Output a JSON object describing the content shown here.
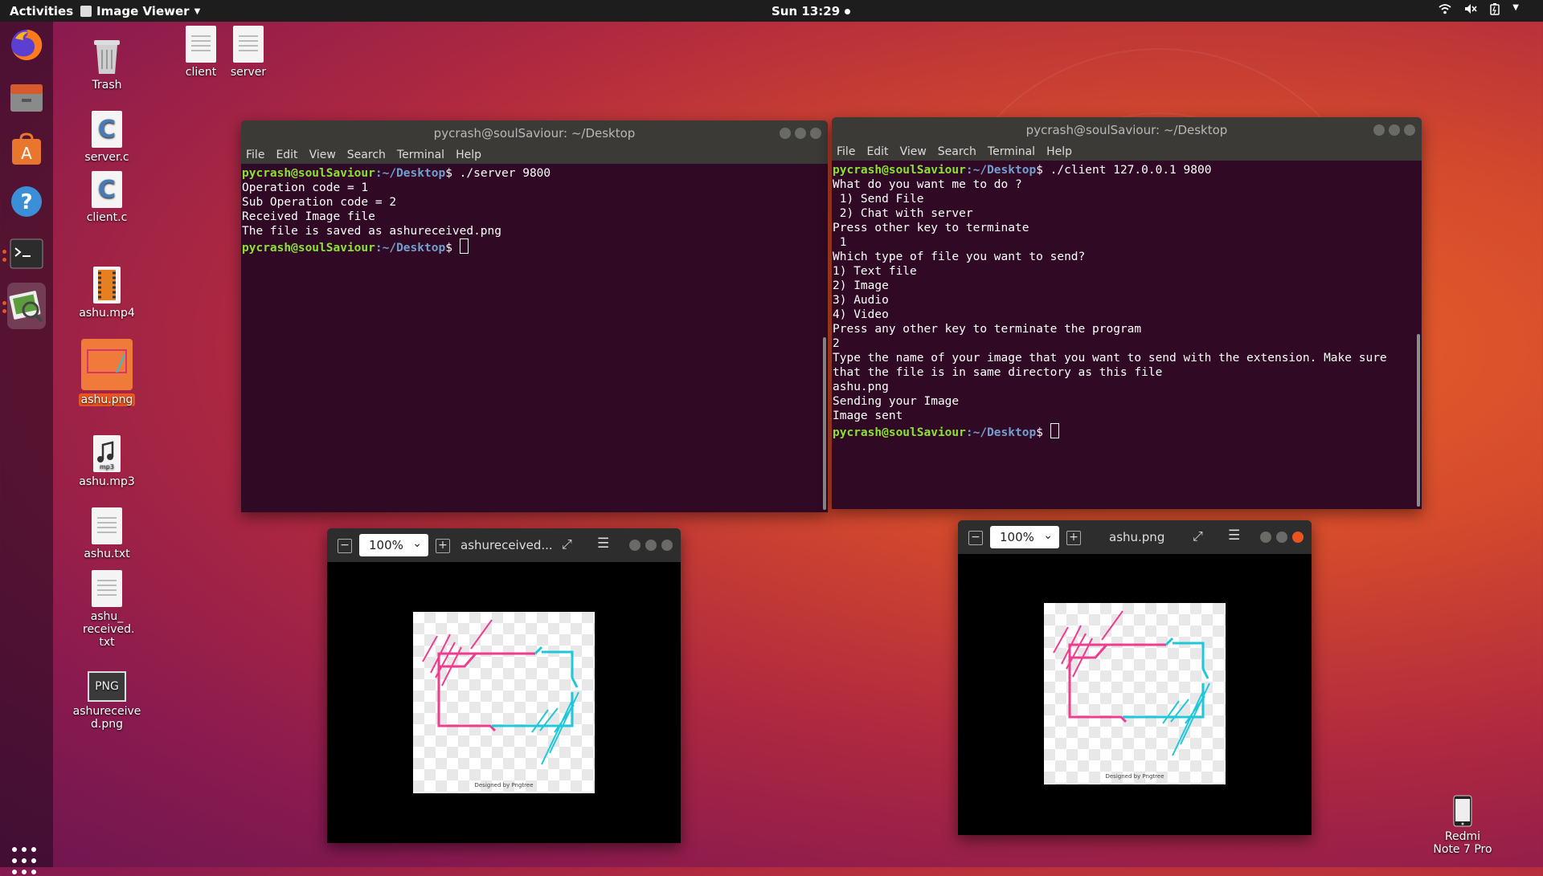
{
  "topbar": {
    "activities": "Activities",
    "app_name": "Image Viewer",
    "clock": "Sun 13:29"
  },
  "dock": {
    "items": [
      {
        "name": "firefox-icon"
      },
      {
        "name": "files-icon"
      },
      {
        "name": "software-icon"
      },
      {
        "name": "help-icon"
      },
      {
        "name": "terminal-icon"
      },
      {
        "name": "image-viewer-icon"
      }
    ]
  },
  "desktop": {
    "icons": [
      {
        "label": "Trash",
        "type": "trash"
      },
      {
        "label": "client",
        "type": "doc"
      },
      {
        "label": "server",
        "type": "doc"
      },
      {
        "label": "server.c",
        "type": "c"
      },
      {
        "label": "client.c",
        "type": "c"
      },
      {
        "label": "ashu.mp4",
        "type": "video"
      },
      {
        "label": "ashu.png",
        "type": "image"
      },
      {
        "label": "ashu.mp3",
        "type": "audio"
      },
      {
        "label": "ashu.txt",
        "type": "doc"
      },
      {
        "label": "ashu_ received. txt",
        "type": "doc"
      },
      {
        "label": "ashureceive d.png",
        "type": "png"
      }
    ],
    "phone": {
      "label": "Redmi Note 7 Pro"
    }
  },
  "terminal_server": {
    "title": "pycrash@soulSaviour: ~/Desktop",
    "menu": [
      "File",
      "Edit",
      "View",
      "Search",
      "Terminal",
      "Help"
    ],
    "prompt_user": "pycrash@soulSaviour",
    "prompt_path": ":~/Desktop",
    "command": "$ ./server 9800",
    "output": [
      "Operation code = 1",
      "Sub Operation code = 2",
      "Received Image file",
      "The file is saved as ashureceived.png"
    ],
    "end_prompt_dollar": "$ "
  },
  "terminal_client": {
    "title": "pycrash@soulSaviour: ~/Desktop",
    "menu": [
      "File",
      "Edit",
      "View",
      "Search",
      "Terminal",
      "Help"
    ],
    "prompt_user": "pycrash@soulSaviour",
    "prompt_path": ":~/Desktop",
    "command": "$ ./client 127.0.0.1 9800",
    "output": [
      "What do you want me to do ?",
      " 1) Send File",
      " 2) Chat with server",
      "Press other key to terminate",
      " 1",
      "Which type of file you want to send?",
      "1) Text file",
      "2) Image",
      "3) Audio",
      "4) Video",
      "Press any other key to terminate the program",
      "2",
      "Type the name of your image that you want to send with the extension. Make sure that the file is in same directory as this file",
      "ashu.png",
      "Sending your Image",
      "Image sent"
    ],
    "end_prompt_dollar": "$ "
  },
  "viewer_left": {
    "zoom": "100%",
    "title": "ashureceived...",
    "credit": "Designed by Pngtree"
  },
  "viewer_right": {
    "zoom": "100%",
    "title": "ashu.png",
    "credit": "Designed by Pngtree"
  },
  "colors": {
    "accent": "#e95420",
    "terminal_bg": "#300a24",
    "prompt_user": "#8ae234",
    "prompt_path": "#729fcf",
    "frame_pink": "#ee3d8f",
    "frame_cyan": "#1ec8d8"
  }
}
